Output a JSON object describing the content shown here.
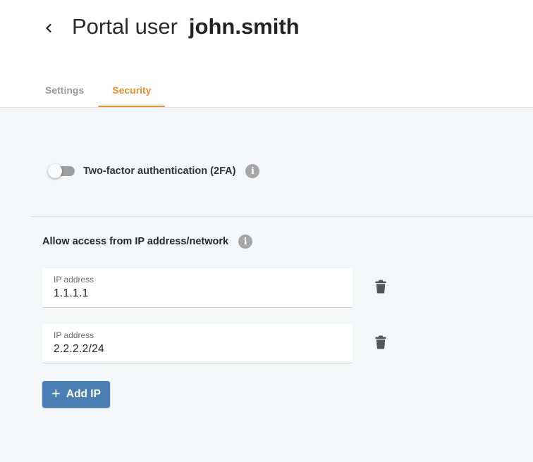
{
  "header": {
    "back_icon": "chevron-left-icon",
    "title_prefix": "Portal user",
    "title_user": "john.smith"
  },
  "tabs": [
    {
      "label": "Settings",
      "active": false
    },
    {
      "label": "Security",
      "active": true
    }
  ],
  "two_factor": {
    "label": "Two-factor authentication (2FA)",
    "enabled": false,
    "info_icon": "info-icon",
    "info_glyph": "i"
  },
  "ip_access": {
    "heading": "Allow access from IP address/network",
    "info_glyph": "i",
    "entries": [
      {
        "label": "IP address",
        "value": "1.1.1.1",
        "delete_icon": "trash-icon"
      },
      {
        "label": "IP address",
        "value": "2.2.2.2/24",
        "delete_icon": "trash-icon"
      }
    ],
    "add_button": {
      "icon": "+",
      "label": "Add IP"
    }
  },
  "colors": {
    "accent": "#ec8f2a",
    "primary_button": "#4a7fb6",
    "content_background": "#f5f6f8",
    "toggle_off_track": "#9e9e9e",
    "info_icon": "#a6a6a6"
  }
}
